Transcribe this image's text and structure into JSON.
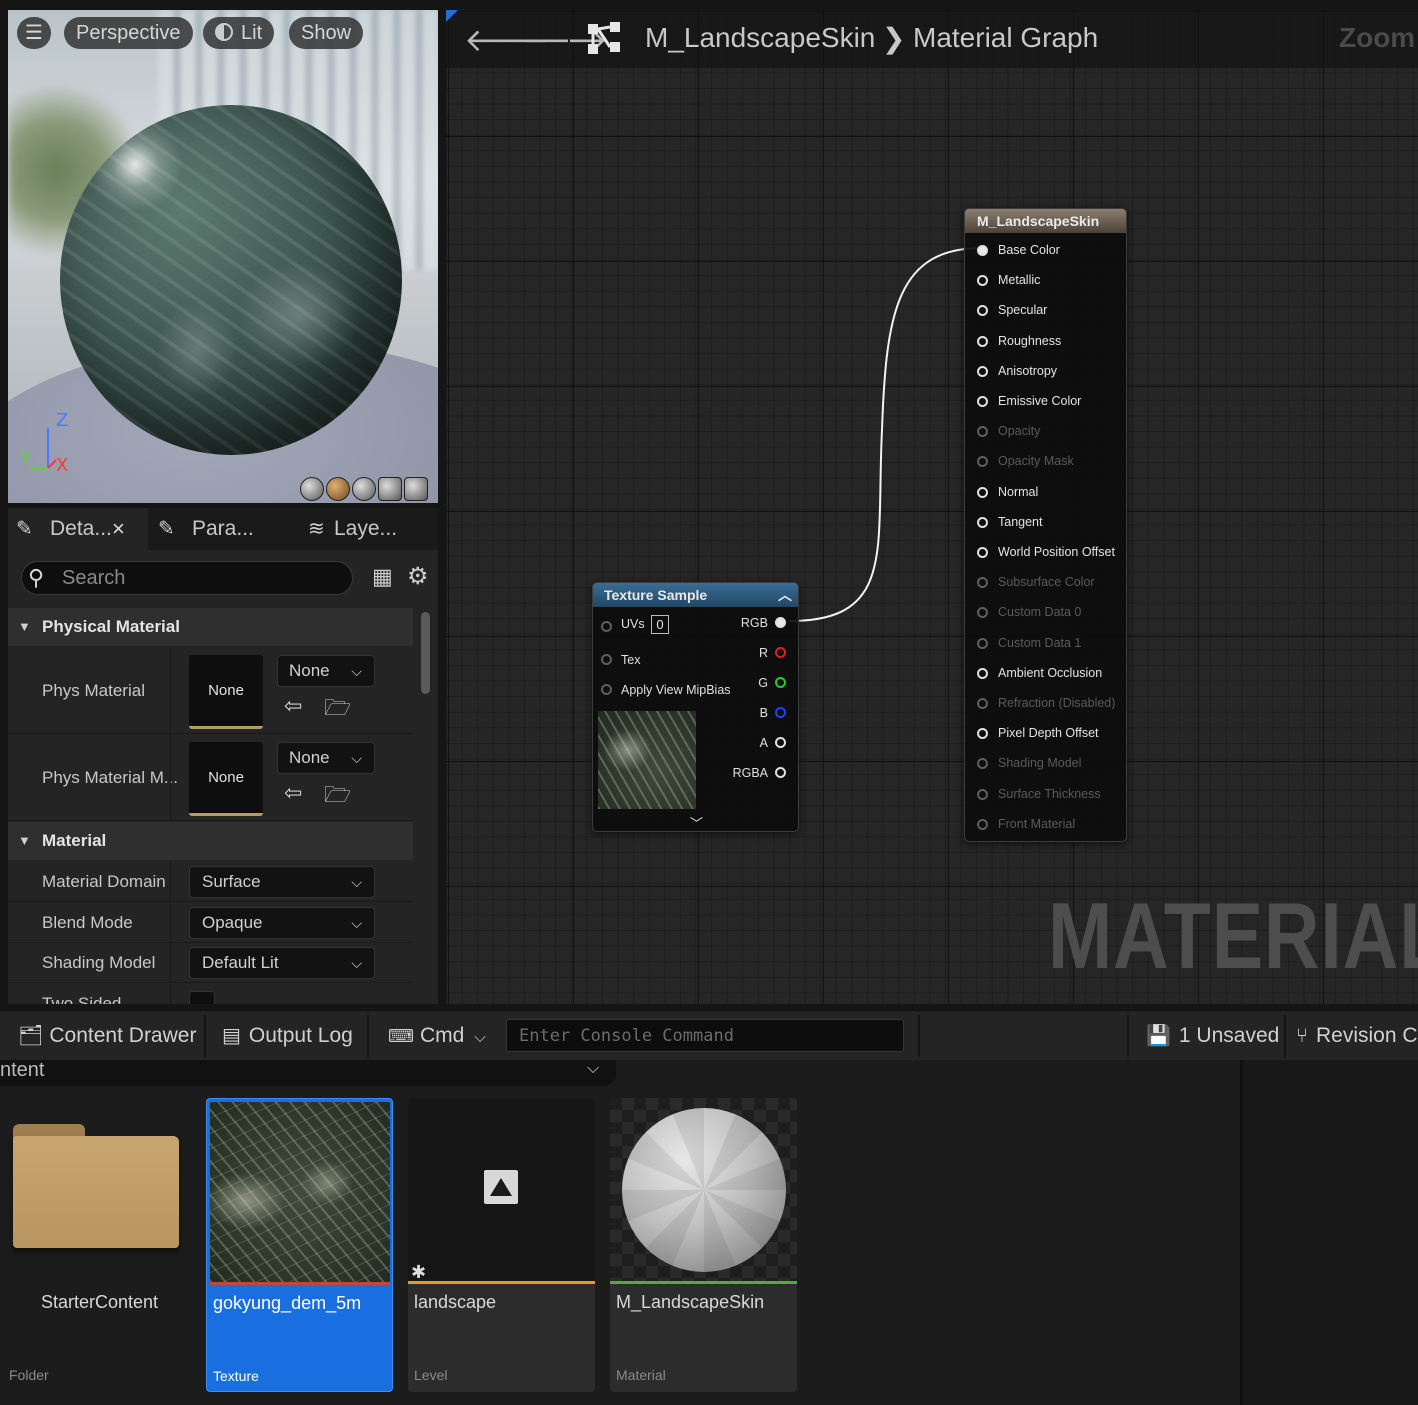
{
  "viewport": {
    "menu_glyph": "☰",
    "perspective_label": "Perspective",
    "lit_label": "Lit",
    "show_label": "Show",
    "axis_z": "Z",
    "axis_y": "Y",
    "axis_x": "X"
  },
  "details": {
    "tabs": [
      {
        "label": "Deta...",
        "icon": "pencil-icon",
        "closable": true
      },
      {
        "label": "Para...",
        "icon": "pencil-icon"
      },
      {
        "label": "Laye...",
        "icon": "layers-icon"
      }
    ],
    "close_glyph": "×",
    "search_placeholder": "Search",
    "sections": {
      "physical_material": {
        "title": "Physical Material",
        "rows": [
          {
            "label": "Phys Material",
            "thumb": "None",
            "combo": "None"
          },
          {
            "label": "Phys Material M...",
            "thumb": "None",
            "combo": "None"
          }
        ]
      },
      "material": {
        "title": "Material",
        "rows": [
          {
            "label": "Material Domain",
            "value": "Surface"
          },
          {
            "label": "Blend Mode",
            "value": "Opaque"
          },
          {
            "label": "Shading Model",
            "value": "Default Lit"
          },
          {
            "label": "Two Sided",
            "value": false
          }
        ]
      }
    }
  },
  "graph": {
    "breadcrumb_material": "M_LandscapeSkin",
    "breadcrumb_sep": "❯",
    "breadcrumb_graph": "Material Graph",
    "zoom_label": "Zoom",
    "watermark": "MATERIAL",
    "texture_node": {
      "title": "Texture Sample",
      "inputs": {
        "uvs": "UVs",
        "uvs_value": "0",
        "tex": "Tex",
        "mipbias": "Apply View MipBias"
      },
      "outputs": [
        "RGB",
        "R",
        "G",
        "B",
        "A",
        "RGBA"
      ],
      "output_colors": [
        "#e8e8e8",
        "#e02020",
        "#20d020",
        "#2040ff",
        "#e0e0e0",
        "#e0e0e0"
      ]
    },
    "material_node": {
      "title": "M_LandscapeSkin",
      "pins": [
        {
          "label": "Base Color",
          "active": true,
          "connected": true
        },
        {
          "label": "Metallic",
          "active": true
        },
        {
          "label": "Specular",
          "active": true
        },
        {
          "label": "Roughness",
          "active": true
        },
        {
          "label": "Anisotropy",
          "active": true
        },
        {
          "label": "Emissive Color",
          "active": true
        },
        {
          "label": "Opacity",
          "active": false
        },
        {
          "label": "Opacity Mask",
          "active": false
        },
        {
          "label": "Normal",
          "active": true
        },
        {
          "label": "Tangent",
          "active": true
        },
        {
          "label": "World Position Offset",
          "active": true
        },
        {
          "label": "Subsurface Color",
          "active": false
        },
        {
          "label": "Custom Data 0",
          "active": false
        },
        {
          "label": "Custom Data 1",
          "active": false
        },
        {
          "label": "Ambient Occlusion",
          "active": true
        },
        {
          "label": "Refraction (Disabled)",
          "active": false
        },
        {
          "label": "Pixel Depth Offset",
          "active": true
        },
        {
          "label": "Shading Model",
          "active": false
        },
        {
          "label": "Surface Thickness",
          "active": false
        },
        {
          "label": "Front Material",
          "active": false
        }
      ]
    }
  },
  "bottombar": {
    "content_drawer": "Content Drawer",
    "output_log": "Output Log",
    "cmd": "Cmd",
    "console_placeholder": "Enter Console Command",
    "unsaved": "1 Unsaved",
    "revision": "Revision C"
  },
  "content_browser": {
    "path": "ntent",
    "assets": [
      {
        "name": "StarterContent",
        "type": "Folder"
      },
      {
        "name": "gokyung_dem_5m",
        "type": "Texture",
        "bar_color": "#c8443a"
      },
      {
        "name": "landscape",
        "type": "Level",
        "bar_color": "#e89a1c"
      },
      {
        "name": "M_LandscapeSkin",
        "type": "Material",
        "bar_color": "#4caf3a"
      }
    ]
  }
}
